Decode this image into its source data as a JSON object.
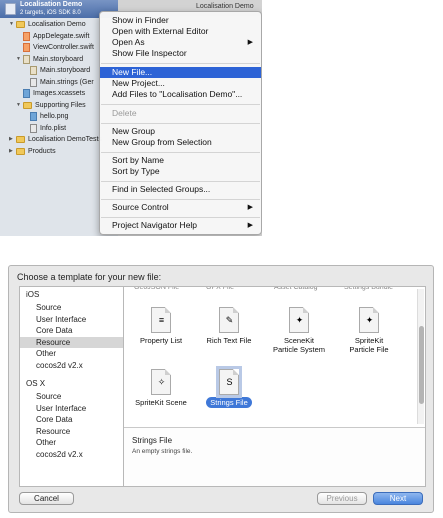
{
  "xcode": {
    "project_name": "Localisation Demo",
    "project_subtitle": "2 targets, iOS SDK 8.0",
    "editor_tab": "Localisation Demo",
    "tree": [
      {
        "label": "Localisation Demo",
        "kind": "folder",
        "indent": 1,
        "tri": "▼"
      },
      {
        "label": "AppDelegate.swift",
        "kind": "swift",
        "indent": 2,
        "tri": ""
      },
      {
        "label": "ViewController.swift",
        "kind": "swift",
        "indent": 2,
        "tri": ""
      },
      {
        "label": "Main.storyboard",
        "kind": "board",
        "indent": 2,
        "tri": "▼"
      },
      {
        "label": "Main.storyboard",
        "kind": "board",
        "indent": 3,
        "tri": ""
      },
      {
        "label": "Main.strings (Ger",
        "kind": "strings",
        "indent": 3,
        "tri": ""
      },
      {
        "label": "Images.xcassets",
        "kind": "img",
        "indent": 2,
        "tri": ""
      },
      {
        "label": "Supporting Files",
        "kind": "folder",
        "indent": 2,
        "tri": "▼"
      },
      {
        "label": "hello.png",
        "kind": "img",
        "indent": 3,
        "tri": ""
      },
      {
        "label": "Info.plist",
        "kind": "strings",
        "indent": 3,
        "tri": ""
      },
      {
        "label": "Localisation DemoTests",
        "kind": "folder",
        "indent": 1,
        "tri": "▶"
      },
      {
        "label": "Products",
        "kind": "folder",
        "indent": 1,
        "tri": "▶"
      }
    ],
    "context_menu": {
      "show_in_finder": "Show in Finder",
      "open_external": "Open with External Editor",
      "open_as": "Open As",
      "show_inspector": "Show File Inspector",
      "new_file": "New File...",
      "new_project": "New Project...",
      "add_files": "Add Files to \"Localisation Demo\"...",
      "delete": "Delete",
      "new_group": "New Group",
      "new_group_sel": "New Group from Selection",
      "sort_name": "Sort by Name",
      "sort_type": "Sort by Type",
      "find_in_groups": "Find in Selected Groups...",
      "source_control": "Source Control",
      "nav_help": "Project Navigator Help",
      "submenu_arrow": "▶"
    }
  },
  "dialog": {
    "title": "Choose a template for your new file:",
    "ios_header": "iOS",
    "ios_items": [
      "Source",
      "User Interface",
      "Core Data",
      "Resource",
      "Other",
      "cocos2d v2.x"
    ],
    "osx_header": "OS X",
    "osx_items": [
      "Source",
      "User Interface",
      "Core Data",
      "Resource",
      "Other",
      "cocos2d v2.x"
    ],
    "cut_labels": [
      "GeoJSON File",
      "GPX File",
      "Asset Catalog",
      "Settings Bundle"
    ],
    "templates": [
      {
        "label": "Property List",
        "glyph": "≡"
      },
      {
        "label": "Rich Text File",
        "glyph": "✎"
      },
      {
        "label": "SceneKit\nParticle System",
        "glyph": "✦"
      },
      {
        "label": "SpriteKit\nParticle File",
        "glyph": "✦"
      },
      {
        "label": "SpriteKit Scene",
        "glyph": "✧"
      },
      {
        "label": "Strings File",
        "glyph": "S"
      }
    ],
    "selected_template": "Strings File",
    "desc_title": "Strings File",
    "desc_text": "An empty strings file.",
    "cancel": "Cancel",
    "previous": "Previous",
    "next": "Next"
  },
  "colors": {
    "highlight": "#2d63d6",
    "selection_blue": "#3f78d8"
  }
}
